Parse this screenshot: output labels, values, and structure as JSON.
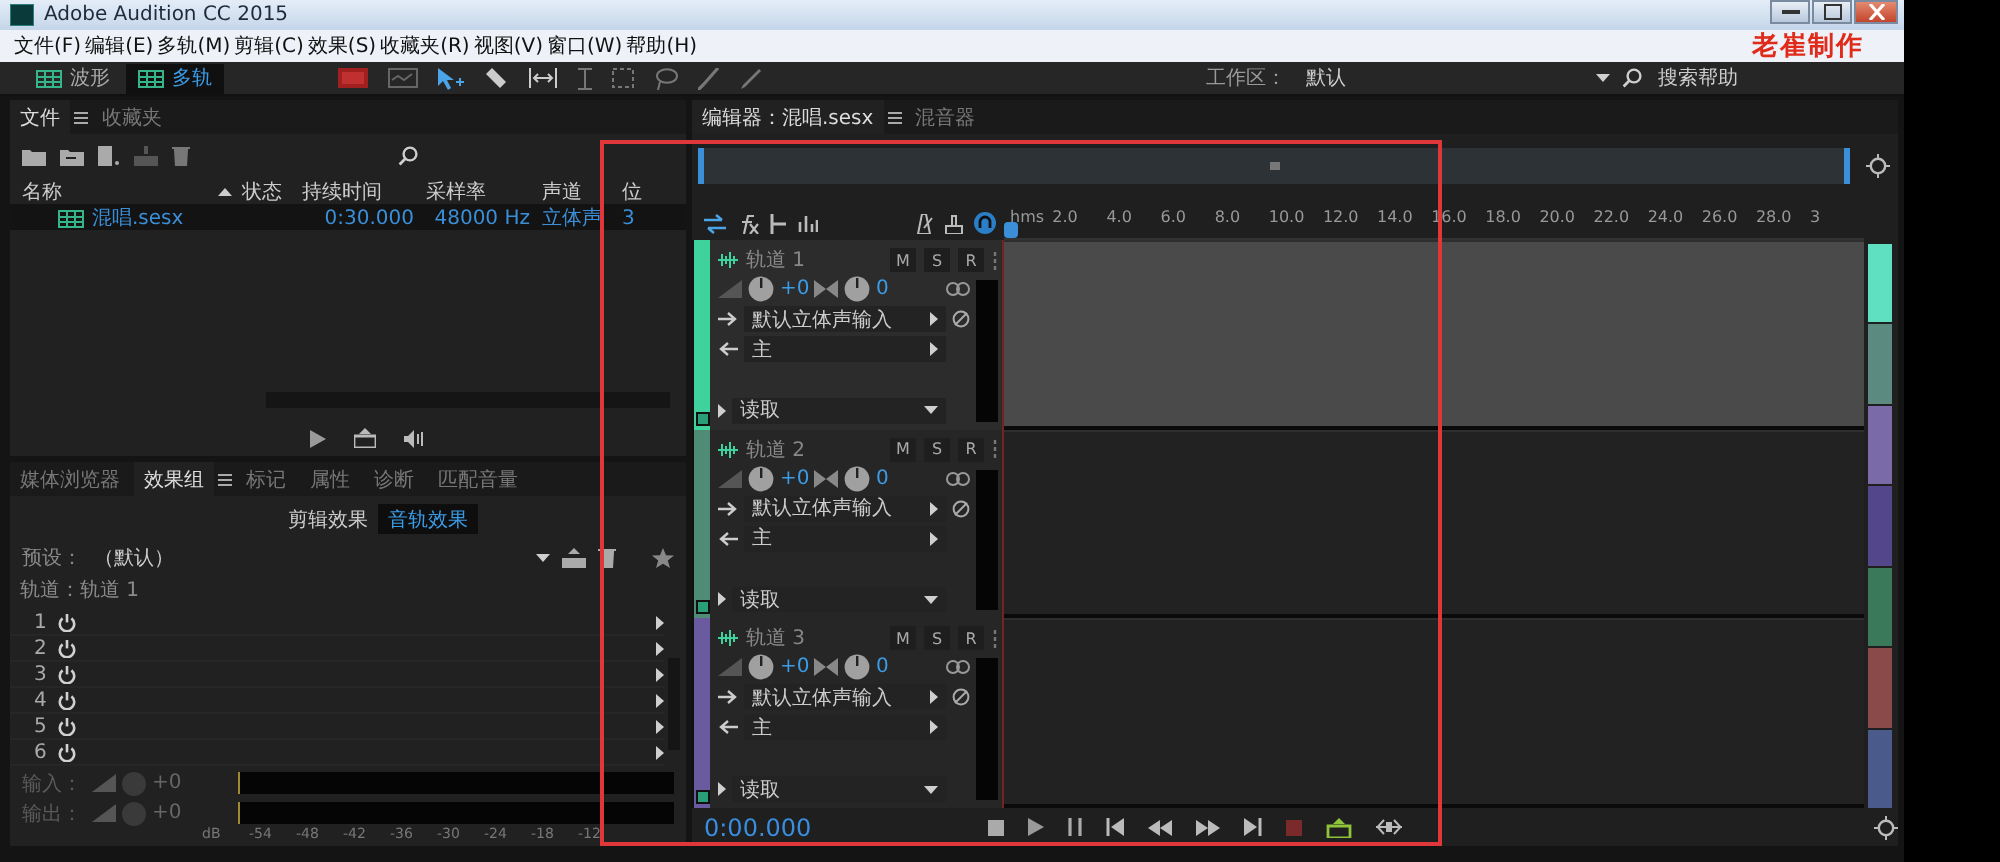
{
  "window": {
    "title": "Adobe Audition CC 2015"
  },
  "menu": [
    "文件(F)",
    "编辑(E)",
    "多轨(M)",
    "剪辑(C)",
    "效果(S)",
    "收藏夹(R)",
    "视图(V)",
    "窗口(W)",
    "帮助(H)"
  ],
  "author_mark": "老崔制作",
  "toolbar": {
    "views": [
      {
        "label": "波形",
        "selected": false
      },
      {
        "label": "多轨",
        "selected": true
      }
    ],
    "workspace_label": "工作区：",
    "workspace": "默认",
    "search_placeholder": "搜索帮助"
  },
  "files_panel": {
    "tabs": [
      {
        "label": "文件",
        "selected": true
      },
      {
        "label": "收藏夹",
        "selected": false
      }
    ],
    "columns": [
      "名称",
      "状态",
      "持续时间",
      "采样率",
      "声道",
      "位"
    ],
    "rows": [
      {
        "name": "混唱.sesx",
        "duration": "0:30.000",
        "sample_rate": "48000 Hz",
        "channels": "立体声",
        "bits": "3",
        "selected": true
      }
    ]
  },
  "effects_panel": {
    "tabs": [
      {
        "label": "媒体浏览器",
        "selected": false
      },
      {
        "label": "效果组",
        "selected": true
      },
      {
        "label": "标记",
        "selected": false
      },
      {
        "label": "属性",
        "selected": false
      },
      {
        "label": "诊断",
        "selected": false
      },
      {
        "label": "匹配音量",
        "selected": false
      }
    ],
    "modes": [
      {
        "label": "剪辑效果",
        "selected": false
      },
      {
        "label": "音轨效果",
        "selected": true
      }
    ],
    "preset_label": "预设：",
    "preset": "（默认）",
    "track_label": "轨道：轨道 1",
    "slots": [
      "1",
      "2",
      "3",
      "4",
      "5",
      "6"
    ],
    "input": {
      "label": "输入：",
      "value": "+0"
    },
    "output": {
      "label": "输出：",
      "value": "+0"
    },
    "scale": [
      "dB",
      "-54",
      "-48",
      "-42",
      "-36",
      "-30",
      "-24",
      "-18",
      "-12"
    ]
  },
  "editor": {
    "tabs": [
      {
        "label": "编辑器：混唱.sesx",
        "selected": true
      },
      {
        "label": "混音器",
        "selected": false
      }
    ],
    "ruler": [
      "hms",
      "2.0",
      "4.0",
      "6.0",
      "8.0",
      "10.0",
      "12.0",
      "14.0",
      "16.0",
      "18.0",
      "20.0",
      "22.0",
      "24.0",
      "26.0",
      "28.0",
      "3"
    ],
    "tracks": [
      {
        "name": "轨道 1",
        "color": "#3fd29c",
        "selected": true,
        "buttons": [
          "M",
          "S",
          "R"
        ],
        "volume": "+0",
        "pan": "0",
        "input": "默认立体声输入",
        "output": "主",
        "automation": "读取"
      },
      {
        "name": "轨道 2",
        "color": "#4e8c76",
        "selected": false,
        "buttons": [
          "M",
          "S",
          "R"
        ],
        "volume": "+0",
        "pan": "0",
        "input": "默认立体声输入",
        "output": "主",
        "automation": "读取"
      },
      {
        "name": "轨道 3",
        "color": "#6a5aa0",
        "selected": false,
        "buttons": [
          "M",
          "S",
          "R"
        ],
        "volume": "+0",
        "pan": "0",
        "input": "默认立体声输入",
        "output": "主",
        "automation": "读取"
      }
    ],
    "track_map": [
      {
        "color": "#5fe0c0"
      },
      {
        "color": "#5a8a80"
      },
      {
        "color": "#7a6aa8"
      },
      {
        "color": "#54468a"
      },
      {
        "color": "#3a7a5a"
      },
      {
        "color": "#8a4a4a"
      },
      {
        "color": "#4a5a8a"
      }
    ],
    "timecode": "0:00.000"
  }
}
